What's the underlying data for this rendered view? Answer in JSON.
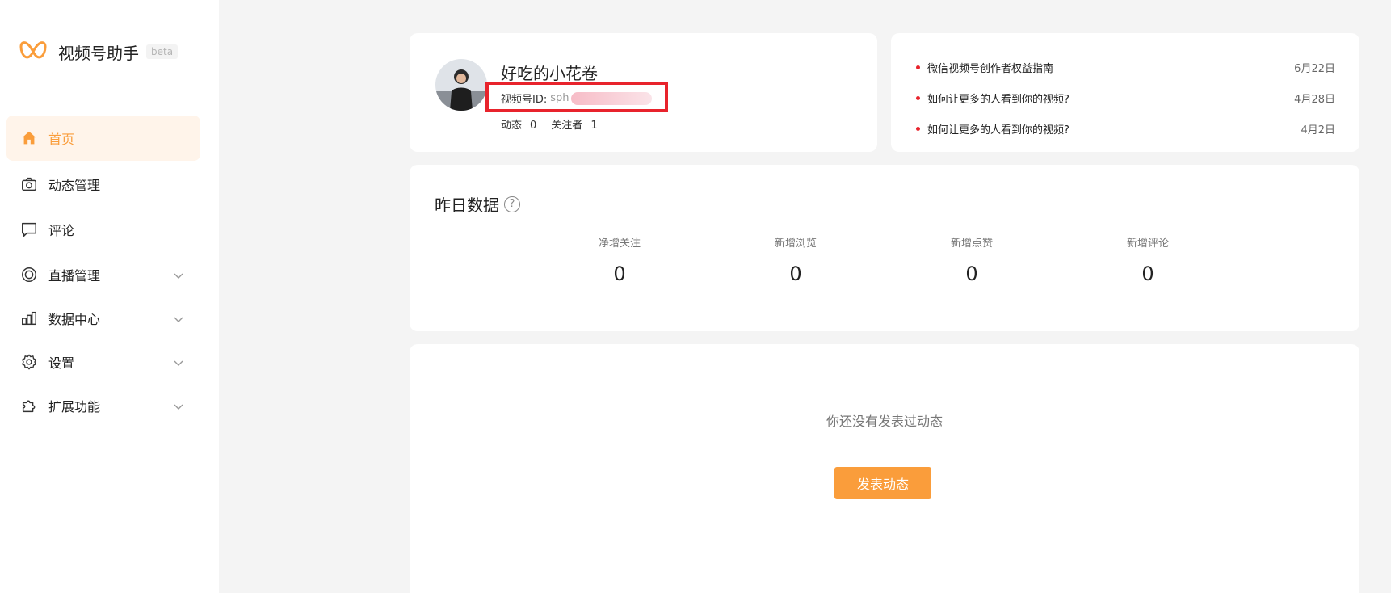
{
  "brand": {
    "name": "视频号助手",
    "badge": "beta",
    "accent": "#fa9d3b"
  },
  "nav": [
    {
      "label": "首页",
      "icon": "home-icon",
      "active": true,
      "expandable": false
    },
    {
      "label": "动态管理",
      "icon": "camera-icon",
      "active": false,
      "expandable": false
    },
    {
      "label": "评论",
      "icon": "comment-icon",
      "active": false,
      "expandable": false
    },
    {
      "label": "直播管理",
      "icon": "live-icon",
      "active": false,
      "expandable": true
    },
    {
      "label": "数据中心",
      "icon": "chart-icon",
      "active": false,
      "expandable": true
    },
    {
      "label": "设置",
      "icon": "gear-icon",
      "active": false,
      "expandable": true
    },
    {
      "label": "扩展功能",
      "icon": "puzzle-icon",
      "active": false,
      "expandable": true
    }
  ],
  "profile": {
    "nickname": "好吃的小花卷",
    "id_label": "视频号ID:",
    "id_value": "sph",
    "posts_label": "动态",
    "posts_count": "0",
    "followers_label": "关注者",
    "followers_count": "1"
  },
  "news": [
    {
      "title": "微信视频号创作者权益指南",
      "date": "6月22日"
    },
    {
      "title": "如何让更多的人看到你的视频?",
      "date": "4月28日"
    },
    {
      "title": "如何让更多的人看到你的视频?",
      "date": "4月2日"
    }
  ],
  "yesterday": {
    "title": "昨日数据",
    "help": "?",
    "metrics": [
      {
        "label": "净增关注",
        "value": "0"
      },
      {
        "label": "新增浏览",
        "value": "0"
      },
      {
        "label": "新增点赞",
        "value": "0"
      },
      {
        "label": "新增评论",
        "value": "0"
      }
    ]
  },
  "posts": {
    "empty_text": "你还没有发表过动态",
    "publish_label": "发表动态"
  }
}
